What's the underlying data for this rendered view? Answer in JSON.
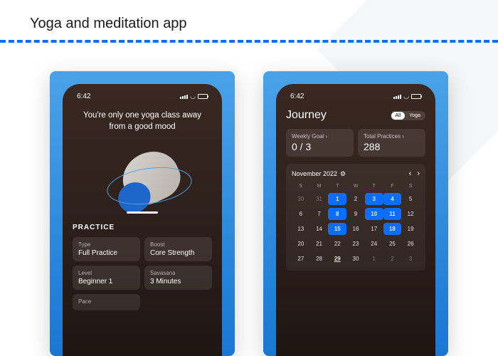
{
  "title": "Yoga and meditation app",
  "status_time": "6:42",
  "screen1": {
    "tagline": "You're only one yoga class away from a good mood",
    "practice_label": "PRACTICE",
    "cards": [
      {
        "label": "Type",
        "value": "Full Practice"
      },
      {
        "label": "Boost",
        "value": "Core Strength"
      },
      {
        "label": "Level",
        "value": "Beginner 1"
      },
      {
        "label": "Savasana",
        "value": "3 Minutes"
      },
      {
        "label": "Pace",
        "value": ""
      }
    ]
  },
  "screen2": {
    "title": "Journey",
    "toggle": {
      "all": "All",
      "yoga": "Yoga"
    },
    "goal_label": "Weekly Goal",
    "goal_value": "0 / 3",
    "total_label": "Total Practices",
    "total_value": "288",
    "month": "November 2022",
    "dow": [
      "S",
      "M",
      "T",
      "W",
      "T",
      "F",
      "S"
    ],
    "days": [
      {
        "n": "30",
        "muted": true
      },
      {
        "n": "31",
        "muted": true
      },
      {
        "n": "1",
        "hl": true
      },
      {
        "n": "2"
      },
      {
        "n": "3",
        "hl": true
      },
      {
        "n": "4",
        "hl": true
      },
      {
        "n": "5"
      },
      {
        "n": "6"
      },
      {
        "n": "7"
      },
      {
        "n": "8",
        "hl": true
      },
      {
        "n": "9"
      },
      {
        "n": "10",
        "hl": true
      },
      {
        "n": "11",
        "hl": true
      },
      {
        "n": "12"
      },
      {
        "n": "13"
      },
      {
        "n": "14"
      },
      {
        "n": "15",
        "hl": true
      },
      {
        "n": "16"
      },
      {
        "n": "17"
      },
      {
        "n": "18",
        "hl": true
      },
      {
        "n": "19"
      },
      {
        "n": "20"
      },
      {
        "n": "21"
      },
      {
        "n": "22"
      },
      {
        "n": "23"
      },
      {
        "n": "24"
      },
      {
        "n": "25"
      },
      {
        "n": "26"
      },
      {
        "n": "27"
      },
      {
        "n": "28"
      },
      {
        "n": "29",
        "today": true
      },
      {
        "n": "30"
      },
      {
        "n": "1",
        "muted": true
      },
      {
        "n": "2",
        "muted": true
      },
      {
        "n": "3",
        "muted": true
      }
    ]
  }
}
